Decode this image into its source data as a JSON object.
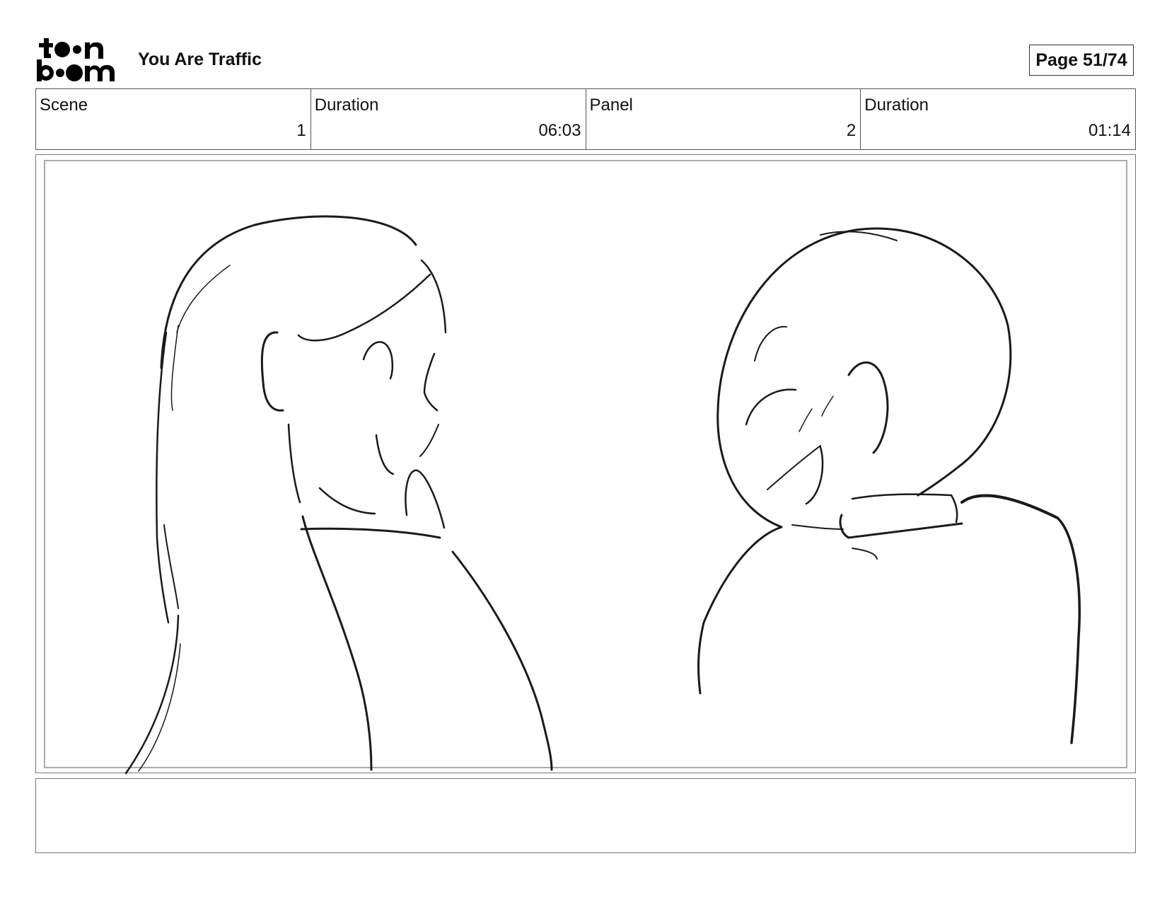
{
  "header": {
    "logo_text": "toon boom",
    "project_title": "You Are Traffic",
    "page_label": "Page 51/74"
  },
  "info": {
    "scene_label": "Scene",
    "scene_value": "1",
    "scene_duration_label": "Duration",
    "scene_duration_value": "06:03",
    "panel_label": "Panel",
    "panel_value": "2",
    "panel_duration_label": "Duration",
    "panel_duration_value": "01:14"
  },
  "notes": {
    "text": ""
  }
}
